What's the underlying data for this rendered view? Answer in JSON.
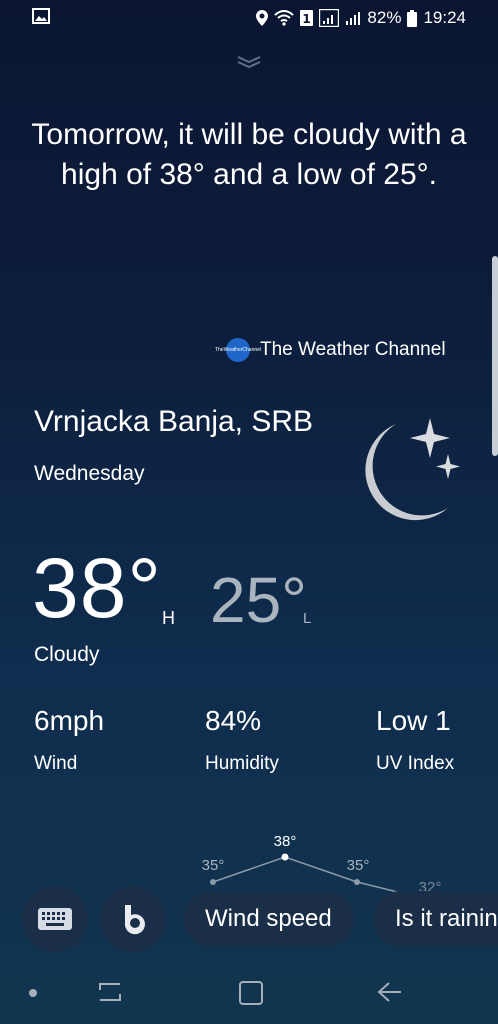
{
  "status_bar": {
    "battery": "82%",
    "time": "19:24",
    "icons": [
      "image-icon",
      "location-icon",
      "wifi-icon",
      "sim-1-icon",
      "signal-icon",
      "signal-2-icon",
      "battery-icon"
    ]
  },
  "summary": "Tomorrow, it will be cloudy with a high of 38° and a low of 25°.",
  "source": {
    "name": "The Weather Channel",
    "logo_text": [
      "The",
      "Weather",
      "Channel"
    ]
  },
  "weather": {
    "location": "Vrnjacka Banja, SRB",
    "day": "Wednesday",
    "high": "38°",
    "high_marker": "H",
    "low": "25°",
    "low_marker": "L",
    "condition": "Cloudy",
    "icon": "moon-stars-icon"
  },
  "stats": [
    {
      "value": "6mph",
      "label": "Wind"
    },
    {
      "value": "84%",
      "label": "Humidity"
    },
    {
      "value": "Low 1",
      "label": "UV Index"
    }
  ],
  "temp_graph": {
    "labels": [
      "35°",
      "38°",
      "35°",
      "32°"
    ]
  },
  "suggestions": [
    "Wind speed",
    "Is it raining"
  ],
  "colors": {
    "accent_blue": "#1e67c8",
    "chip_bg": "#1a2f47",
    "low_temp": "#aab4bf"
  }
}
